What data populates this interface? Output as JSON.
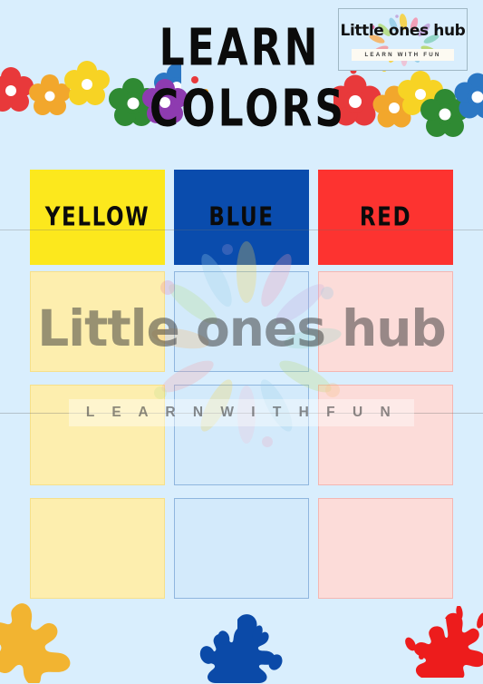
{
  "page": {
    "background_color": "#d9eefd",
    "title_lines": [
      "LEARN",
      "COLORS"
    ]
  },
  "logo": {
    "name": "Little ones hub",
    "tagline": "LEARN WITH FUN",
    "burst_icon": "color-burst-icon"
  },
  "watermark": {
    "name": "Little ones hub",
    "tagline": "L E A R N   W I T H   F U N",
    "burst_icon": "color-burst-icon"
  },
  "decorations": {
    "flower_garland_left_icon": "flower-garland-icon",
    "flower_garland_right_icon": "flower-garland-icon",
    "flower_colors": [
      "#e8393b",
      "#f2a72c",
      "#f7d324",
      "#2f8a33",
      "#2b77c4",
      "#8e3bb0"
    ],
    "splat_yellow_icon": "paint-splat-icon",
    "splat_blue_icon": "paint-splat-icon",
    "splat_red_icon": "paint-splat-icon",
    "splat_colors": {
      "yellow": "#f2b431",
      "blue": "#0b4aa8",
      "red": "#ed1c1c"
    }
  },
  "worksheet": {
    "columns": [
      {
        "label": "YELLOW",
        "header_color": "#fce81d",
        "cell_fill": "#fdeeae",
        "cell_border": "#f6e08a",
        "blank_cells": [
          "",
          "",
          ""
        ]
      },
      {
        "label": "BLUE",
        "header_color": "#0a4cad",
        "cell_fill": "#d3eafb",
        "cell_border": "#8fb6de",
        "blank_cells": [
          "",
          "",
          ""
        ]
      },
      {
        "label": "RED",
        "header_color": "#fd3330",
        "cell_fill": "#fcdcd9",
        "cell_border": "#f4b6b2",
        "blank_cells": [
          "",
          "",
          ""
        ]
      }
    ]
  }
}
